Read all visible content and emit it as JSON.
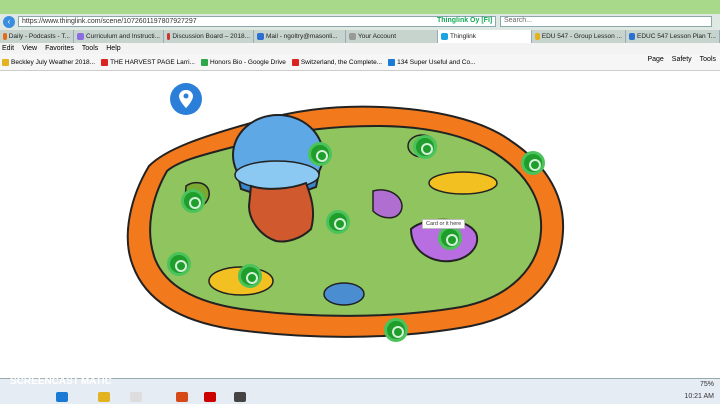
{
  "browser": {
    "url": "https://www.thinglink.com/scene/1072601197807927297",
    "site_badge": "Thinglink Oy [FI]",
    "search_placeholder": "Search..."
  },
  "tabs": [
    {
      "label": "Daily - Podcasts - T...",
      "color": "#e26b16"
    },
    {
      "label": "Curriculum and Instructi...",
      "color": "#8a6de0"
    },
    {
      "label": "Discussion Board – 2018...",
      "color": "#c33"
    },
    {
      "label": "Mail - ngoltry@masonli...",
      "color": "#2b6fd0"
    },
    {
      "label": "Your Account",
      "color": "#999"
    },
    {
      "label": "Thinglink",
      "color": "#1aa4e0",
      "active": true
    },
    {
      "label": "EDU 547 - Group Lesson ...",
      "color": "#e2b21f"
    },
    {
      "label": "EDUC 547 Lesson Plan T...",
      "color": "#2b6fd0"
    }
  ],
  "menu": [
    "Edit",
    "View",
    "Favorites",
    "Tools",
    "Help"
  ],
  "favorites": [
    {
      "label": "Beckley July Weather 2018...",
      "color": "#e2b21f"
    },
    {
      "label": "THE HARVEST PAGE  Larri...",
      "color": "#d22"
    },
    {
      "label": "Honors Bio - Google Drive",
      "color": "#2da84a"
    },
    {
      "label": "Switzerland, the Complete...",
      "color": "#d22"
    },
    {
      "label": "134 Super Useful and Co...",
      "color": "#1a7ad6"
    }
  ],
  "toolbar": {
    "page": "Page",
    "safety": "Safety",
    "tools": "Tools"
  },
  "image": {
    "card_label": "Card or it here"
  },
  "status": {
    "zoom": "75%",
    "time": "10:21 AM"
  },
  "watermark": {
    "line1": "RECORDED WITH",
    "line2": "SCREENCAST",
    "line3": "MATIC"
  }
}
